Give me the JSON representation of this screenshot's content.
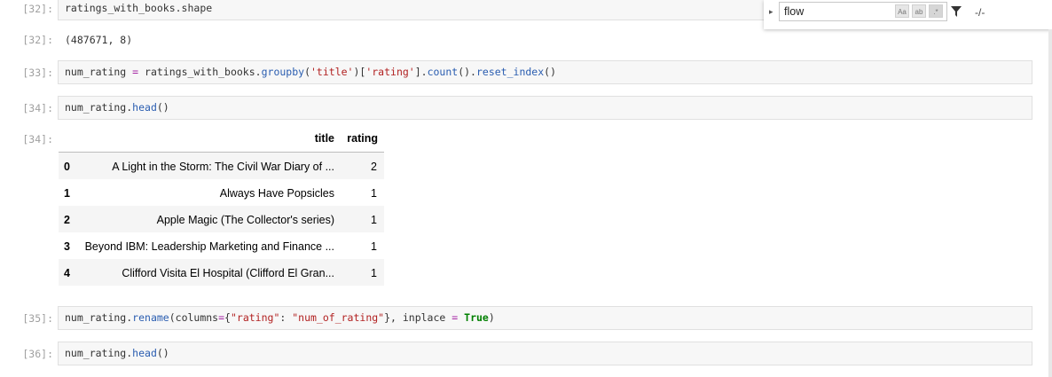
{
  "cells": [
    {
      "in_prompt": "[32]:",
      "code": "ratings_with_books.shape",
      "out_prompt": "[32]:",
      "output": "(487671, 8)"
    },
    {
      "in_prompt": "[33]:",
      "code_parts": [
        "num_rating ",
        "=",
        " ratings_with_books.",
        "groupby",
        "(",
        "'title'",
        ")[",
        "'rating'",
        "].",
        "count",
        "().",
        "reset_index",
        "()"
      ]
    },
    {
      "in_prompt": "[34]:",
      "code_parts": [
        "num_rating.",
        "head",
        "()"
      ],
      "out_prompt": "[34]:"
    },
    {
      "in_prompt": "[35]:",
      "code_parts": [
        "num_rating.",
        "rename",
        "(columns",
        "=",
        "{",
        "\"rating\"",
        ": ",
        "\"num_of_rating\"",
        "}, inplace ",
        "=",
        " ",
        "True",
        ")"
      ]
    },
    {
      "in_prompt": "[36]:",
      "code_parts": [
        "num_rating.",
        "head",
        "()"
      ]
    }
  ],
  "dataframe": {
    "columns": [
      "title",
      "rating"
    ],
    "rows": [
      {
        "index": "0",
        "title": "A Light in the Storm: The Civil War Diary of ...",
        "rating": "2"
      },
      {
        "index": "1",
        "title": "Always Have Popsicles",
        "rating": "1"
      },
      {
        "index": "2",
        "title": "Apple Magic (The Collector's series)",
        "rating": "1"
      },
      {
        "index": "3",
        "title": "Beyond IBM: Leadership Marketing and Finance ...",
        "rating": "1"
      },
      {
        "index": "4",
        "title": "Clifford Visita El Hospital (Clifford El Gran...",
        "rating": "1"
      }
    ]
  },
  "find_widget": {
    "query": "flow",
    "match_case_label": "Aa",
    "whole_word_label": "ab",
    "regex_label": ".*",
    "filter_icon": "funnel-icon",
    "result_count": "-/-"
  }
}
